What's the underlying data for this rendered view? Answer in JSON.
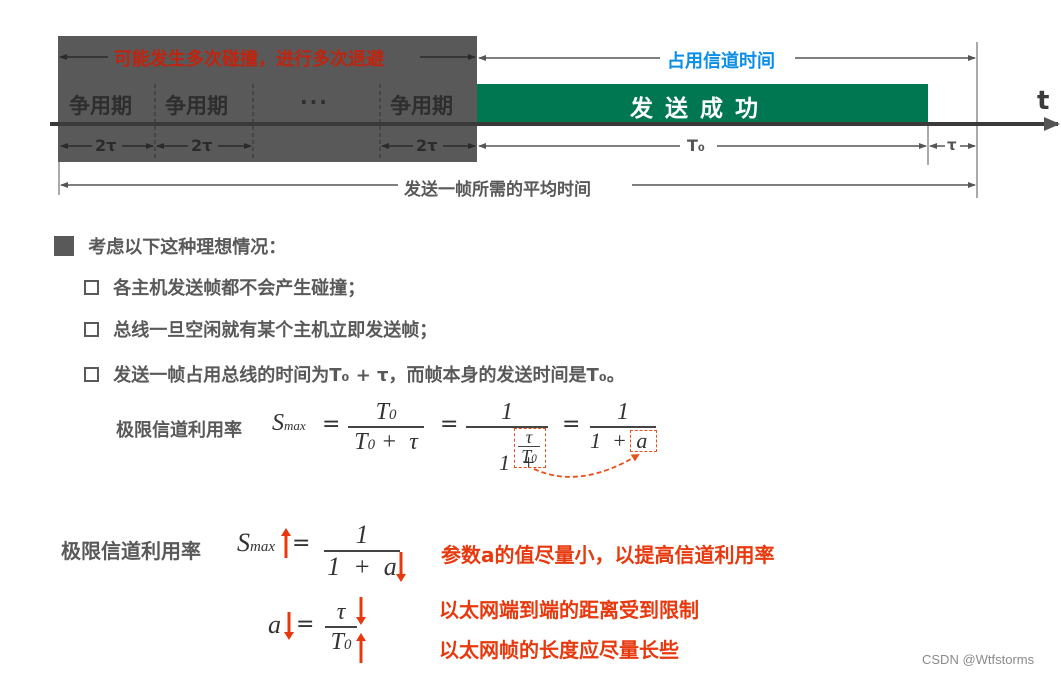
{
  "timeline": {
    "collision_label": "可能发生多次碰撞，进行多次退避",
    "channel_label": "占用信道时间",
    "contention_periods": [
      "争用期",
      "争用期",
      "争用期"
    ],
    "ellipsis": "···",
    "success_label": "发 送 成 功",
    "axis_label": "t",
    "period_label": "2τ",
    "t0_label": "T₀",
    "tau_label": "τ",
    "total_label": "发送一帧所需的平均时间",
    "colors": {
      "contention_bg": "#595959",
      "success_bg": "#007651",
      "collision_text": "#c0240e",
      "channel_text": "#0a8ee8"
    }
  },
  "conditions": {
    "heading": "考虑以下这种理想情况：",
    "items": [
      "各主机发送帧都不会产生碰撞；",
      "总线一旦空闲就有某个主机立即发送帧；",
      "发送一帧占用总线的时间为T₀ + τ，而帧本身的发送时间是T₀。"
    ]
  },
  "formula1": {
    "label": "极限信道利用率",
    "lhs": "S",
    "lhs_sub": "max",
    "eq": "=",
    "f1_num": "T",
    "f1_num_sub": "0",
    "f1_den": "T",
    "f1_den_sub": "0",
    "f1_den_rest": " +  τ",
    "f2_num": "1",
    "f2_den": "1  + ",
    "f2_inner_num": "τ",
    "f2_inner_den": "T",
    "f2_inner_den_sub": "0",
    "f3_num": "1",
    "f3_den": "1  + ",
    "f3_a": "a"
  },
  "formula2": {
    "label": "极限信道利用率",
    "lhs": "S",
    "lhs_sub": "max",
    "eq": "=",
    "num": "1",
    "den": "1  +  a",
    "a_lhs": "a",
    "a_num": "τ",
    "a_den": "T",
    "a_den_sub": "0"
  },
  "notes": {
    "note1": "参数a的值尽量小，以提高信道利用率",
    "note2": "以太网端到端的距离受到限制",
    "note3": "以太网帧的长度应尽量长些",
    "accent_color": "#e8380d"
  },
  "watermark": "CSDN @Wtfstorms"
}
